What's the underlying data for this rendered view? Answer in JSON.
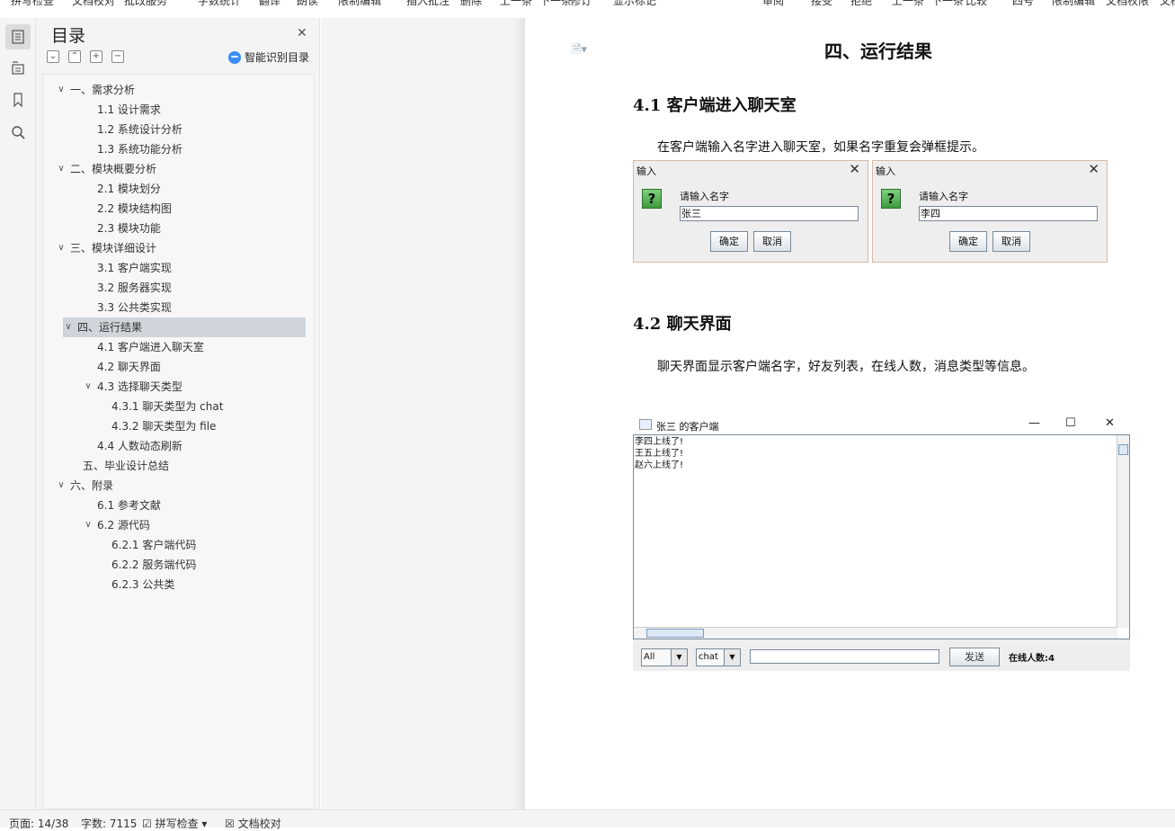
{
  "topbar": {
    "items": [
      "拼写检查",
      "文档校对",
      "批改服务",
      "字数统计",
      "翻译",
      "朗读",
      "限制编辑",
      "插入批注",
      "删除",
      "上一条",
      "下一条",
      "修订",
      "显示标记",
      "审阅",
      "接受",
      "拒绝",
      "上一条",
      "下一条",
      "比较",
      "四号",
      "限制编辑",
      "文档权限",
      "文档"
    ]
  },
  "rail": {
    "icons": [
      "toc-icon",
      "outline-icon",
      "bookmark-icon",
      "search-icon"
    ]
  },
  "toc": {
    "title": "目录",
    "smart_label": "智能识别目录",
    "tools": [
      "⌄",
      "⌃",
      "+",
      "−"
    ],
    "items": [
      {
        "label": "一、需求分析",
        "chev": "∨"
      },
      {
        "label": "1.1  设计需求"
      },
      {
        "label": "1.2  系统设计分析"
      },
      {
        "label": "1.3  系统功能分析"
      },
      {
        "label": "二、模块概要分析",
        "chev": "∨"
      },
      {
        "label": "2.1  模块划分"
      },
      {
        "label": "2.2  模块结构图"
      },
      {
        "label": "2.3  模块功能"
      },
      {
        "label": "三、模块详细设计",
        "chev": "∨"
      },
      {
        "label": "3.1  客户端实现"
      },
      {
        "label": "3.2  服务器实现"
      },
      {
        "label": "3.3  公共类实现"
      },
      {
        "label": "四、运行结果",
        "chev": "∨",
        "selected": true
      },
      {
        "label": "4.1  客户端进入聊天室"
      },
      {
        "label": "4.2  聊天界面"
      },
      {
        "label": "4.3  选择聊天类型",
        "chev": "∨"
      },
      {
        "label": "4.3.1  聊天类型为 chat"
      },
      {
        "label": "4.3.2  聊天类型为 file"
      },
      {
        "label": "4.4  人数动态刷新"
      },
      {
        "label": "五、毕业设计总结"
      },
      {
        "label": "六、附录",
        "chev": "∨"
      },
      {
        "label": "6.1  参考文献"
      },
      {
        "label": "6.2  源代码",
        "chev": "∨"
      },
      {
        "label": "6.2.1 客户端代码"
      },
      {
        "label": "6.2.2 服务端代码"
      },
      {
        "label": "6.2.3  公共类"
      }
    ]
  },
  "doc": {
    "h1": "四、运行结果",
    "h2_1": "4.1  客户端进入聊天室",
    "para1": "在客户端输入名字进入聊天室，如果名字重复会弹框提示。",
    "h2_2": "4.2  聊天界面",
    "para2": "聊天界面显示客户端名字，好友列表，在线人数，消息类型等信息。"
  },
  "dialogs": [
    {
      "title": "输入",
      "prompt": "请输入名字",
      "value": "张三",
      "ok": "确定",
      "cancel": "取消"
    },
    {
      "title": "输入",
      "prompt": "请输入名字",
      "value": "李四",
      "ok": "确定",
      "cancel": "取消"
    }
  ],
  "chat": {
    "title": "张三 的客户端",
    "messages": [
      "李四上线了!",
      "王五上线了!",
      "赵六上线了!"
    ],
    "target": "All",
    "type": "chat",
    "send": "发送",
    "online": "在线人数:4"
  },
  "status": {
    "page": "页面: 14/38",
    "words": "字数: 7115",
    "spell": "拼写检查",
    "proof": "文档校对"
  }
}
